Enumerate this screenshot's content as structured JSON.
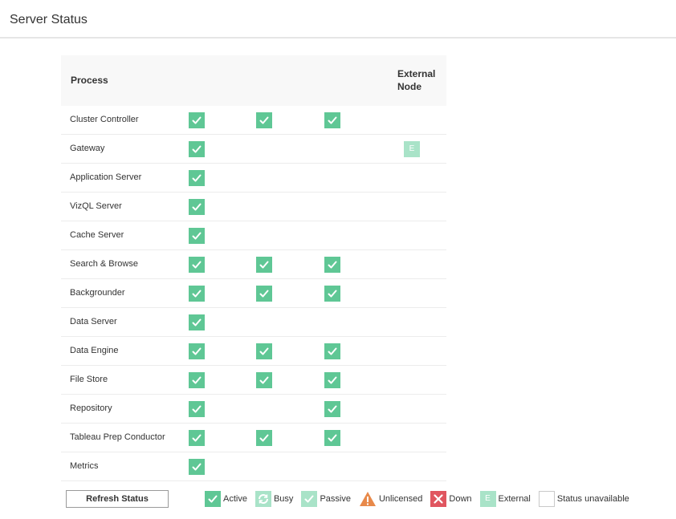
{
  "page": {
    "title": "Server Status"
  },
  "table": {
    "headers": {
      "process": "Process",
      "external": "External Node"
    },
    "rows": [
      {
        "process": "Cluster Controller",
        "nodes": [
          "active",
          "active",
          "active",
          ""
        ]
      },
      {
        "process": "Gateway",
        "nodes": [
          "active",
          "",
          "",
          "external"
        ]
      },
      {
        "process": "Application Server",
        "nodes": [
          "active",
          "",
          "",
          ""
        ]
      },
      {
        "process": "VizQL Server",
        "nodes": [
          "active",
          "",
          "",
          ""
        ]
      },
      {
        "process": "Cache Server",
        "nodes": [
          "active",
          "",
          "",
          ""
        ]
      },
      {
        "process": "Search & Browse",
        "nodes": [
          "active",
          "active",
          "active",
          ""
        ]
      },
      {
        "process": "Backgrounder",
        "nodes": [
          "active",
          "active",
          "active",
          ""
        ]
      },
      {
        "process": "Data Server",
        "nodes": [
          "active",
          "",
          "",
          ""
        ]
      },
      {
        "process": "Data Engine",
        "nodes": [
          "active",
          "active",
          "active",
          ""
        ]
      },
      {
        "process": "File Store",
        "nodes": [
          "active",
          "active",
          "active",
          ""
        ]
      },
      {
        "process": "Repository",
        "nodes": [
          "active",
          "",
          "active",
          ""
        ]
      },
      {
        "process": "Tableau Prep Conductor",
        "nodes": [
          "active",
          "active",
          "active",
          ""
        ]
      },
      {
        "process": "Metrics",
        "nodes": [
          "active",
          "",
          "",
          ""
        ]
      }
    ]
  },
  "footer": {
    "refresh_label": "Refresh Status",
    "legend": [
      {
        "status": "active",
        "label": "Active"
      },
      {
        "status": "busy",
        "label": "Busy"
      },
      {
        "status": "passive",
        "label": "Passive"
      },
      {
        "status": "unlicensed",
        "label": "Unlicensed"
      },
      {
        "status": "down",
        "label": "Down"
      },
      {
        "status": "external",
        "label": "External",
        "glyph": "E"
      },
      {
        "status": "unavailable",
        "label": "Status unavailable"
      }
    ]
  },
  "colors": {
    "active": "#5fc795",
    "passive": "#a9e3c8",
    "unlicensed": "#e8894a",
    "down": "#e05660"
  }
}
